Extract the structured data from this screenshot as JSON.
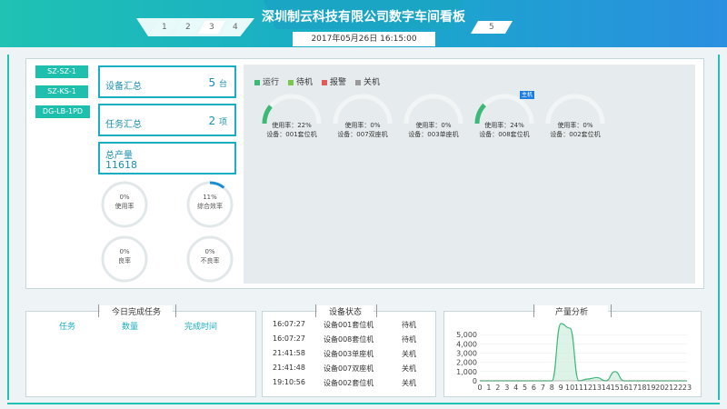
{
  "header": {
    "title": "深圳制云科技有限公司数字车间看板",
    "datetime": "2017年05月26日   16:15:00",
    "tabs": [
      "1",
      "2",
      "3",
      "4"
    ],
    "right_tab": "5"
  },
  "device_list": [
    "SZ-SZ-1",
    "SZ-KS-1",
    "DG-LB-1PD"
  ],
  "summary": {
    "device_label": "设备汇总",
    "device_value": "5",
    "device_unit": "台",
    "task_label": "任务汇总",
    "task_value": "2",
    "task_unit": "项",
    "output_label": "总产量",
    "output_value": "11618"
  },
  "gauges": [
    {
      "value": "0%",
      "label": "使用率",
      "fraction": 0
    },
    {
      "value": "11%",
      "label": "综合效率",
      "fraction": 0.11
    },
    {
      "value": "0%",
      "label": "良率",
      "fraction": 0
    },
    {
      "value": "0%",
      "label": "不良率",
      "fraction": 0
    }
  ],
  "legend": [
    {
      "label": "运行",
      "color": "#3cb878"
    },
    {
      "label": "待机",
      "color": "#7bc74d"
    },
    {
      "label": "报警",
      "color": "#e35a5a"
    },
    {
      "label": "关机",
      "color": "#9a9a9a"
    }
  ],
  "machines": [
    {
      "usage": "使用率：22%",
      "device": "设备：001套位机",
      "fraction": 0.22,
      "badge": ""
    },
    {
      "usage": "使用率：0%",
      "device": "设备：007双座机",
      "fraction": 0,
      "badge": ""
    },
    {
      "usage": "使用率：0%",
      "device": "设备：003单座机",
      "fraction": 0,
      "badge": ""
    },
    {
      "usage": "使用率：24%",
      "device": "设备：008套位机",
      "fraction": 0.24,
      "badge": "主机"
    },
    {
      "usage": "使用率：0%",
      "device": "设备：002套位机",
      "fraction": 0,
      "badge": ""
    }
  ],
  "tasks_panel": {
    "title": "今日完成任务",
    "columns": [
      "任务",
      "数量",
      "完成时间"
    ]
  },
  "status_panel": {
    "title": "设备状态",
    "rows": [
      {
        "time": "16:07:27",
        "device": "设备001套位机",
        "state": "待机"
      },
      {
        "time": "16:07:27",
        "device": "设备008套位机",
        "state": "待机"
      },
      {
        "time": "21:41:58",
        "device": "设备003单座机",
        "state": "关机"
      },
      {
        "time": "21:41:48",
        "device": "设备007双座机",
        "state": "关机"
      },
      {
        "time": "19:10:56",
        "device": "设备002套位机",
        "state": "关机"
      }
    ]
  },
  "chart_data": {
    "type": "area",
    "title": "产量分析",
    "x": [
      0,
      1,
      2,
      3,
      4,
      5,
      6,
      7,
      8,
      9,
      10,
      11,
      12,
      13,
      14,
      15,
      16,
      17,
      18,
      19,
      20,
      21,
      22,
      23
    ],
    "values": [
      0,
      0,
      0,
      0,
      0,
      0,
      0,
      0,
      0,
      6200,
      5700,
      0,
      200,
      350,
      0,
      1000,
      0,
      0,
      0,
      0,
      0,
      0,
      0,
      0
    ],
    "ylim": [
      0,
      6000
    ],
    "yticks": [
      "5,000",
      "4,000",
      "3,000",
      "2,000",
      "1,000",
      "0"
    ],
    "ytick_values": [
      5000,
      4000,
      3000,
      2000,
      1000,
      0
    ],
    "color": "#3cb878"
  }
}
